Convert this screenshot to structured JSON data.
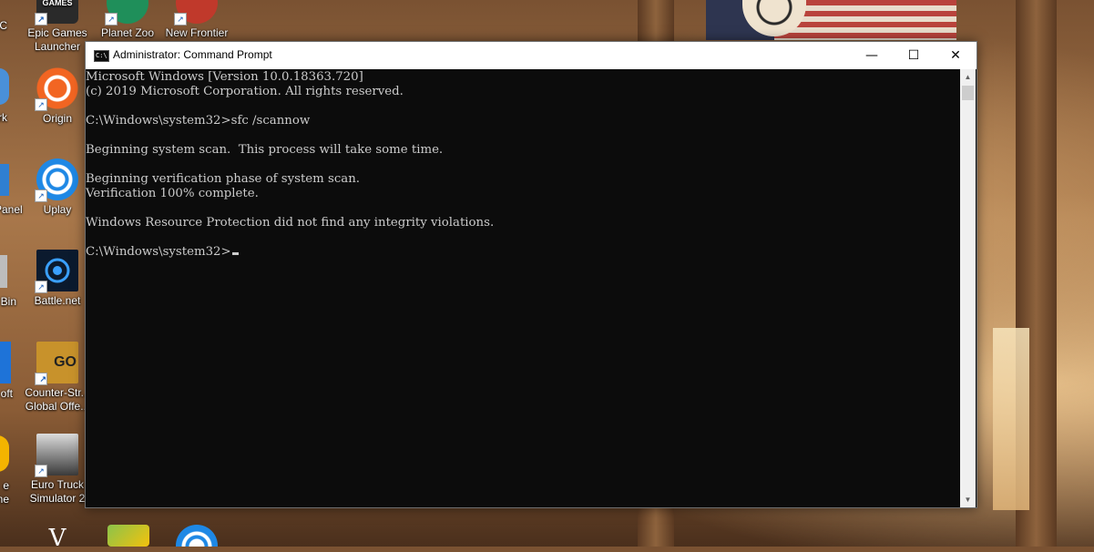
{
  "window": {
    "title": "Administrator: Command Prompt",
    "icon_label": "C:\\",
    "buttons": {
      "minimize": "—",
      "maximize": "☐",
      "close": "✕"
    },
    "scroll": {
      "up": "▲",
      "down": "▼"
    }
  },
  "console": {
    "lines": [
      "Microsoft Windows [Version 10.0.18363.720]",
      "(c) 2019 Microsoft Corporation. All rights reserved.",
      "",
      "C:\\Windows\\system32>sfc /scannow",
      "",
      "Beginning system scan.  This process will take some time.",
      "",
      "Beginning verification phase of system scan.",
      "Verification 100% complete.",
      "",
      "Windows Resource Protection did not find any integrity violations.",
      "",
      "C:\\Windows\\system32>"
    ]
  },
  "desktop": {
    "icons": [
      {
        "label": "Epic Games\nLauncher",
        "icon": "epic-games-icon",
        "color": "#2a2a2a"
      },
      {
        "label": "Planet Zoo",
        "icon": "planet-zoo-icon",
        "color": "#1f8f5a"
      },
      {
        "label": "New Frontier",
        "icon": "new-frontier-icon",
        "color": "#c0392b"
      },
      {
        "label": "Origin",
        "icon": "origin-icon",
        "color": "#f26522"
      },
      {
        "label": "Uplay",
        "icon": "uplay-icon",
        "color": "#1e88e5"
      },
      {
        "label": "Battle.net",
        "icon": "battlenet-icon",
        "color": "#0b1a2e"
      },
      {
        "label": "Counter-Str...\nGlobal Offe...",
        "icon": "csgo-icon",
        "color": "#c8922b"
      },
      {
        "label": "Euro Truck\nSimulator 2",
        "icon": "euro-truck-icon",
        "color": "#3a3a3a"
      }
    ],
    "partial_labels": [
      "C",
      "rk",
      "Panel",
      "Bin",
      "oft",
      "e\nne"
    ],
    "epic_badge": "GAMES",
    "csgo_badge": "GO"
  }
}
